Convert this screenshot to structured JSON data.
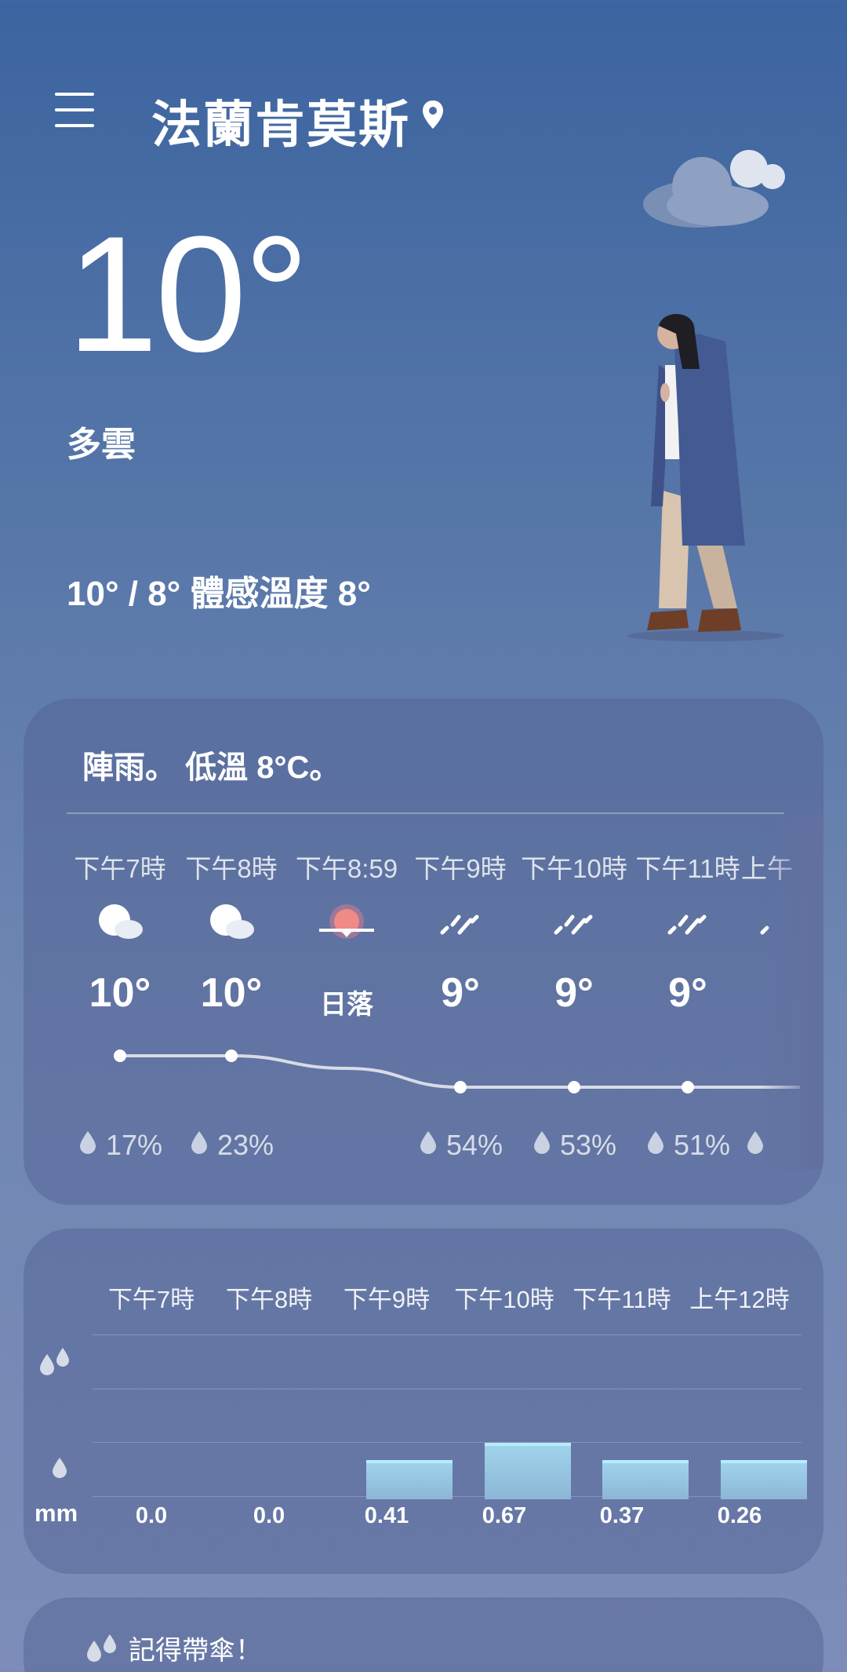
{
  "header": {
    "city": "法蘭肯莫斯"
  },
  "current": {
    "temperature": "10°",
    "condition": "多雲",
    "hi_lo_feels": "10° / 8° 體感溫度 8°"
  },
  "hourly": {
    "summary": "陣雨。 低溫 8°C。",
    "items": [
      {
        "time": "下午7時",
        "icon": "partly-cloudy-icon",
        "temp": "10°",
        "pop": "17%"
      },
      {
        "time": "下午8時",
        "icon": "partly-cloudy-icon",
        "temp": "10°",
        "pop": "23%"
      },
      {
        "time": "下午8:59",
        "icon": "sunset-icon",
        "temp": "日落",
        "pop": ""
      },
      {
        "time": "下午9時",
        "icon": "rain-icon",
        "temp": "9°",
        "pop": "54%"
      },
      {
        "time": "下午10時",
        "icon": "rain-icon",
        "temp": "9°",
        "pop": "53%"
      },
      {
        "time": "下午11時",
        "icon": "rain-icon",
        "temp": "9°",
        "pop": "51%"
      },
      {
        "time": "上午",
        "icon": "rain-icon",
        "temp": "",
        "pop": ""
      }
    ],
    "temp_values": [
      10,
      10,
      9.6,
      9,
      9,
      9,
      9
    ]
  },
  "precip": {
    "unit": "mm",
    "times": [
      "下午7時",
      "下午8時",
      "下午9時",
      "下午10時",
      "下午11時",
      "上午12時"
    ],
    "values": [
      "0.0",
      "0.0",
      "0.41",
      "0.67",
      "0.37",
      "0.26"
    ],
    "numeric": [
      0.0,
      0.0,
      0.41,
      0.67,
      0.37,
      0.26
    ]
  },
  "umbrella": {
    "text": "記得帶傘！"
  },
  "colors": {
    "rain_bar": "#9fd3ea",
    "sunset": "#f08a86"
  }
}
